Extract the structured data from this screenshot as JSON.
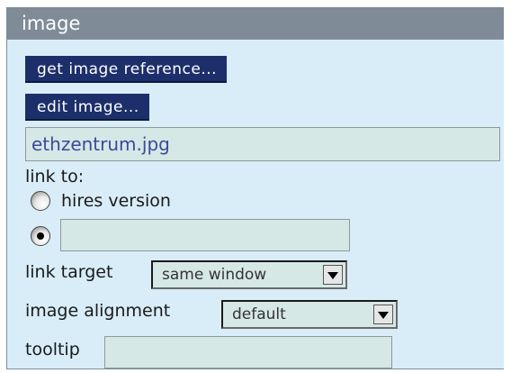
{
  "panel": {
    "title": "image",
    "get_ref_label": "get image reference...",
    "edit_label": "edit image...",
    "filename": "ethzentrum.jpg",
    "link_to_label": "link to:",
    "radio_hires_label": "hires version",
    "radio_hires_checked": false,
    "radio_custom_checked": true,
    "custom_link_value": "",
    "link_target_label": "link target",
    "link_target_value": "same window",
    "alignment_label": "image alignment",
    "alignment_value": "default",
    "tooltip_label": "tooltip",
    "tooltip_value": ""
  },
  "colors": {
    "panel_bg": "#d8edf8",
    "titlebar_bg": "#7f8b97",
    "button_bg": "#1c2f6b",
    "field_bg": "#d6e8e6",
    "filename_text": "#3a4a9a"
  },
  "icons": {
    "select_arrow": "chevron-down-icon",
    "radio": "radio-icon"
  }
}
